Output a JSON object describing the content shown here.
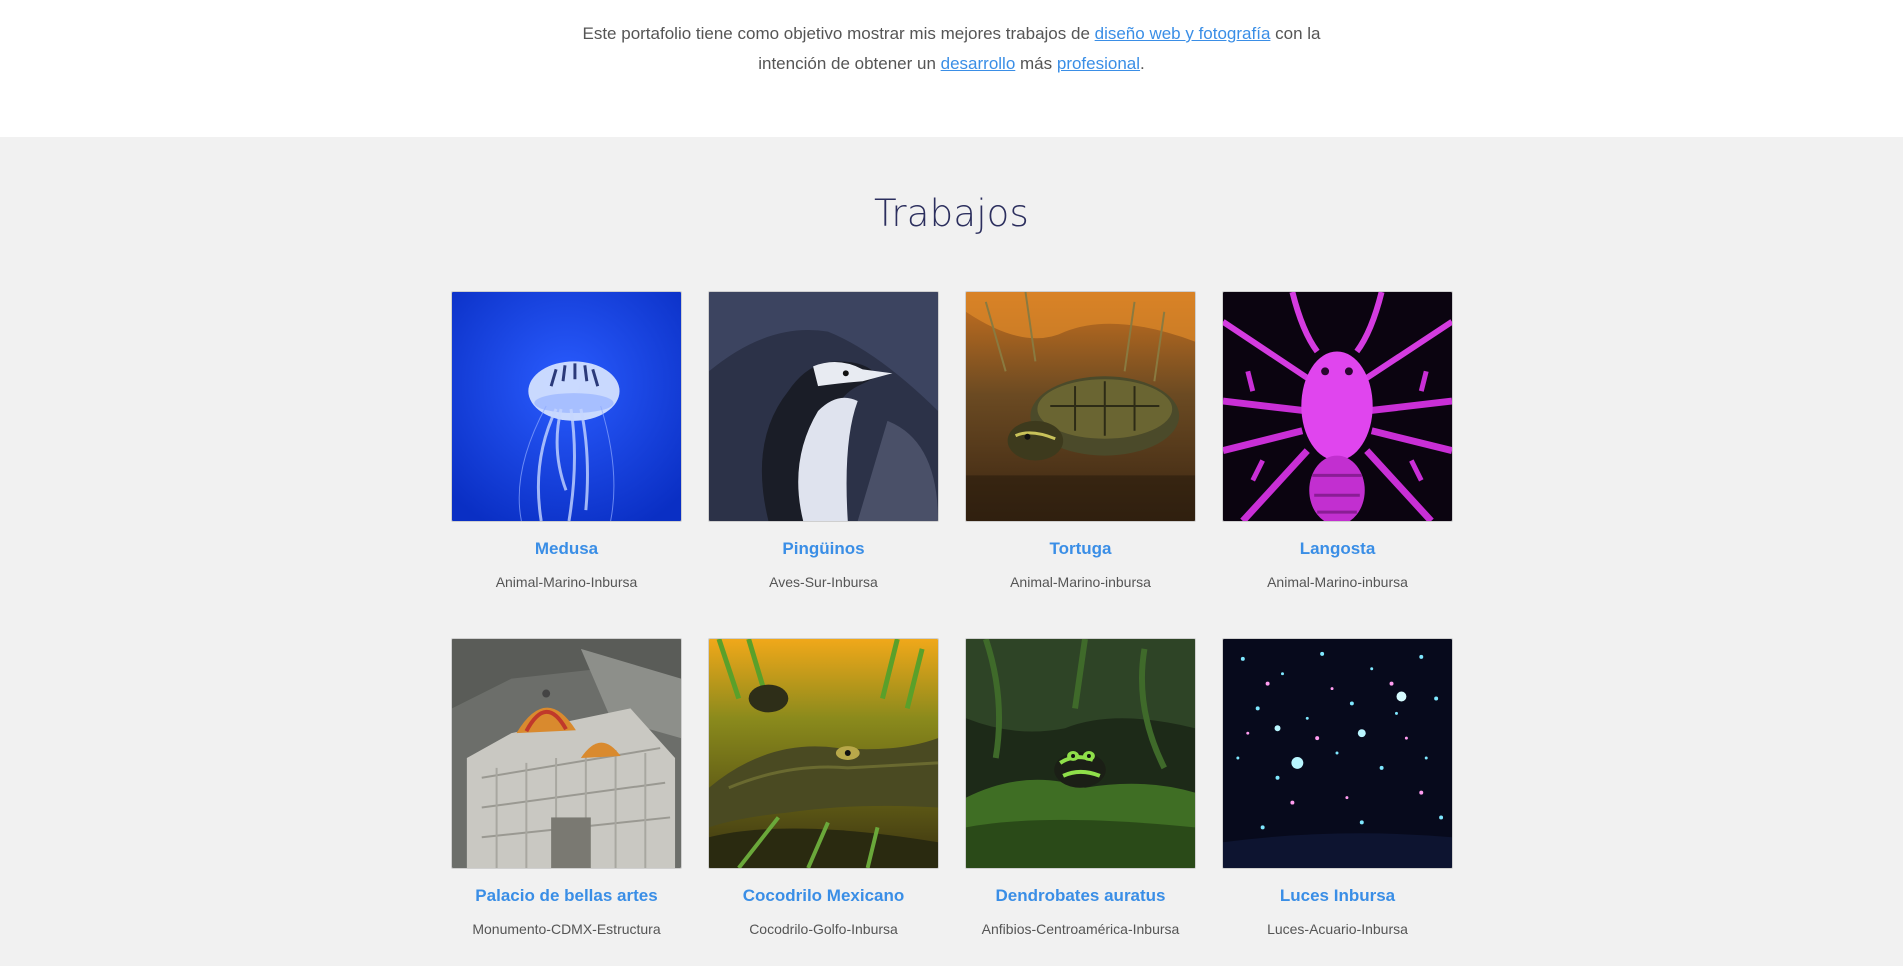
{
  "intro": {
    "text_1": "Este portafolio tiene como objetivo mostrar mis mejores trabajos de ",
    "link_1": "diseño web y fotografía",
    "text_2": " con la intención de obtener un ",
    "link_2": "desarrollo",
    "text_3": " más ",
    "link_3": "profesional",
    "text_4": "."
  },
  "works": {
    "title": "Trabajos",
    "items": [
      {
        "title": "Medusa",
        "subtitle": "Animal-Marino-Inbursa",
        "image": "jellyfish-photo"
      },
      {
        "title": "Pingüinos",
        "subtitle": "Aves-Sur-Inbursa",
        "image": "penguin-photo"
      },
      {
        "title": "Tortuga",
        "subtitle": "Animal-Marino-inbursa",
        "image": "turtle-photo"
      },
      {
        "title": "Langosta",
        "subtitle": "Animal-Marino-inbursa",
        "image": "lobster-photo"
      },
      {
        "title": "Palacio de bellas artes",
        "subtitle": "Monumento-CDMX-Estructura",
        "image": "palace-photo"
      },
      {
        "title": "Cocodrilo Mexicano",
        "subtitle": "Cocodrilo-Golfo-Inbursa",
        "image": "crocodile-photo"
      },
      {
        "title": "Dendrobates auratus",
        "subtitle": "Anfibios-Centroamérica-Inbursa",
        "image": "frog-photo"
      },
      {
        "title": "Luces Inbursa",
        "subtitle": "Luces-Acuario-Inbursa",
        "image": "lights-photo"
      }
    ]
  },
  "colors": {
    "link": "#3a8ee6",
    "heading": "#2c2f5e",
    "section_bg": "#f1f1f1",
    "text": "#555555"
  }
}
